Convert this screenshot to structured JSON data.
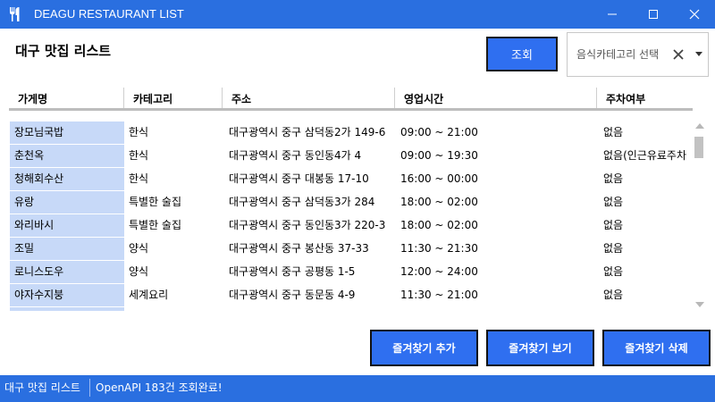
{
  "window": {
    "title": "DEAGU RESTAURANT LIST",
    "controls": [
      "minimize-icon",
      "maximize-icon",
      "close-icon"
    ]
  },
  "header": {
    "title": "대구 맛집 리스트",
    "search_button": "조회",
    "category_combo": {
      "placeholder": "음식카테고리 선택"
    }
  },
  "table": {
    "columns": [
      "가게명",
      "카테고리",
      "주소",
      "영업시간",
      "주차여부"
    ],
    "rows": [
      {
        "name": "장모님국밥",
        "category": "한식",
        "address": "대구광역시 중구 삼덕동2가 149-6",
        "hours": "09:00 ~ 21:00",
        "parking": "없음"
      },
      {
        "name": "춘천옥",
        "category": "한식",
        "address": "대구광역시 중구 동인동4가 4",
        "hours": "09:00 ~ 19:30",
        "parking": "없음(인근유료주차"
      },
      {
        "name": "청해회수산",
        "category": "한식",
        "address": "대구광역시 중구 대봉동 17-10",
        "hours": "16:00 ~ 00:00",
        "parking": "없음"
      },
      {
        "name": "유랑",
        "category": "특별한 술집",
        "address": "대구광역시 중구 삼덕동3가 284",
        "hours": "18:00 ~ 02:00",
        "parking": "없음"
      },
      {
        "name": "와리바시",
        "category": "특별한 술집",
        "address": "대구광역시 중구 동인동3가 220-3",
        "hours": "18:00 ~ 02:00",
        "parking": "없음"
      },
      {
        "name": "조밀",
        "category": "양식",
        "address": "대구광역시 중구 봉산동 37-33",
        "hours": "11:30 ~ 21:30",
        "parking": "없음"
      },
      {
        "name": "로니스도우",
        "category": "양식",
        "address": "대구광역시 중구 공평동 1-5",
        "hours": "12:00 ~ 24:00",
        "parking": "없음"
      },
      {
        "name": "야자수지붕",
        "category": "세계요리",
        "address": "대구광역시 중구 동문동 4-9",
        "hours": "11:30 ~ 21:00",
        "parking": "없음"
      },
      {
        "name": "",
        "category": "",
        "address": "",
        "hours": "",
        "parking": ""
      }
    ]
  },
  "favorites": {
    "add_label": "즐겨찾기 추가",
    "view_label": "즐겨찾기 보기",
    "delete_label": "즐겨찾기 삭제"
  },
  "status": {
    "app_name": "대구 맛집 리스트",
    "message": "OpenAPI 183건 조회완료!"
  },
  "colors": {
    "accent": "#2a6fe0",
    "button": "#2f6ff0",
    "row_highlight": "#c7d9f8"
  }
}
